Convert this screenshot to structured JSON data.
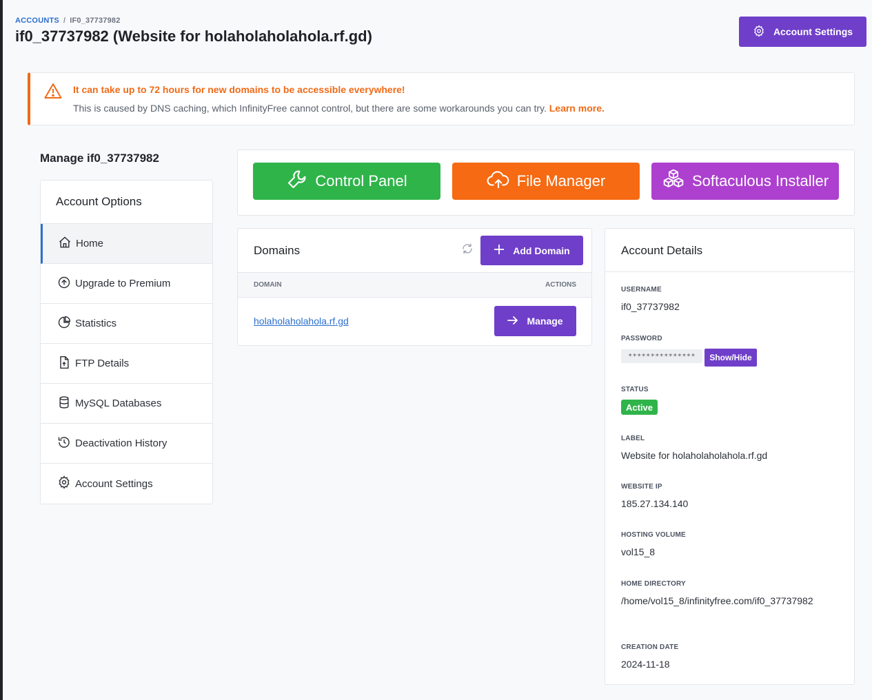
{
  "breadcrumb": {
    "root": "ACCOUNTS",
    "sep": "/",
    "current": "IF0_37737982"
  },
  "page_title": "if0_37737982 (Website for holaholaholahola.rf.gd)",
  "header_button": {
    "label": "Account Settings",
    "icon": "gear-icon"
  },
  "alert": {
    "title": "It can take up to 72 hours for new domains to be accessible everywhere!",
    "text": "This is caused by DNS caching, which InfinityFree cannot control, but there are some workarounds you can try.",
    "link": "Learn more.",
    "color": "#f06a16"
  },
  "sidebar": {
    "heading": "Manage if0_37737982",
    "title": "Account Options",
    "items": [
      {
        "label": "Home",
        "icon": "home-icon",
        "active": true
      },
      {
        "label": "Upgrade to Premium",
        "icon": "arrow-up-circle-icon"
      },
      {
        "label": "Statistics",
        "icon": "pie-chart-icon"
      },
      {
        "label": "FTP Details",
        "icon": "file-upload-icon"
      },
      {
        "label": "MySQL Databases",
        "icon": "database-icon"
      },
      {
        "label": "Deactivation History",
        "icon": "history-icon"
      },
      {
        "label": "Account Settings",
        "icon": "gear-icon"
      }
    ]
  },
  "quick_buttons": [
    {
      "label": "Control Panel",
      "icon": "wrench-icon",
      "color": "#2fb44a"
    },
    {
      "label": "File Manager",
      "icon": "cloud-upload-icon",
      "color": "#f56a12"
    },
    {
      "label": "Softaculous Installer",
      "icon": "cubes-icon",
      "color": "#ad40cf"
    }
  ],
  "domains": {
    "title": "Domains",
    "add_label": "Add Domain",
    "columns": [
      "DOMAIN",
      "ACTIONS"
    ],
    "rows": [
      {
        "domain": "holaholaholahola.rf.gd",
        "action": "Manage"
      }
    ]
  },
  "details": {
    "title": "Account Details",
    "username_label": "USERNAME",
    "username": "if0_37737982",
    "password_label": "PASSWORD",
    "password_mask": "***************",
    "showhide": "Show/Hide",
    "status_label": "STATUS",
    "status": "Active",
    "label_label": "LABEL",
    "label": "Website for holaholaholahola.rf.gd",
    "ip_label": "WEBSITE IP",
    "ip": "185.27.134.140",
    "volume_label": "HOSTING VOLUME",
    "volume": "vol15_8",
    "homedir_label": "HOME DIRECTORY",
    "homedir": "/home/vol15_8/infinityfree.com/if0_37737982",
    "created_label": "CREATION DATE",
    "created": "2024-11-18"
  },
  "colors": {
    "accent": "#6f3fc9",
    "link": "#2c6fcf",
    "success": "#2fb44a"
  }
}
